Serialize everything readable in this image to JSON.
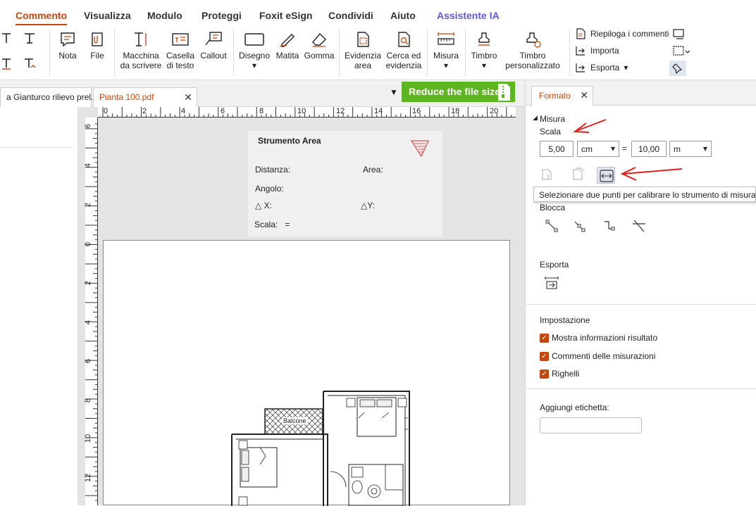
{
  "tabs": [
    {
      "label": "Commento"
    },
    {
      "label": "Visualizza"
    },
    {
      "label": "Modulo"
    },
    {
      "label": "Proteggi"
    },
    {
      "label": "Foxit eSign"
    },
    {
      "label": "Condividi"
    },
    {
      "label": "Aiuto"
    },
    {
      "label": "Assistente IA"
    }
  ],
  "ribbon": {
    "nota": "Nota",
    "file": "File",
    "macchina_1": "Macchina",
    "macchina_2": "da scrivere",
    "casella_1": "Casella",
    "casella_2": "di testo",
    "callout": "Callout",
    "disegno": "Disegno",
    "matita": "Matita",
    "gomma": "Gomma",
    "evidenzia_1": "Evidenzia",
    "evidenzia_2": "area",
    "cerca_1": "Cerca ed",
    "cerca_2": "evidenzia",
    "misura": "Misura",
    "timbro": "Timbro",
    "timbro_pers_1": "Timbro",
    "timbro_pers_2": "personalizzato",
    "riepiloga": "Riepiloga i commenti",
    "importa": "Importa",
    "esporta": "Esporta"
  },
  "doc_tabs": [
    {
      "label": "a Gianturco rilievo prel..."
    },
    {
      "label": "Pianta 100.pdf"
    }
  ],
  "reduce_banner": "Reduce the file size",
  "ruler_top_ticks": [
    "0",
    "2",
    "4",
    "6",
    "8",
    "10",
    "12",
    "14",
    "16",
    "18",
    "20"
  ],
  "ruler_left_ticks": [
    "6",
    "4",
    "2",
    "0",
    "2",
    "4",
    "6",
    "8",
    "10",
    "12"
  ],
  "measure_box": {
    "title": "Strumento Area",
    "distanza": "Distanza:",
    "area": "Area:",
    "angolo": "Angolo:",
    "dx": "X:",
    "dy": "Y:",
    "scala": "Scala:",
    "eq": "="
  },
  "plan": {
    "balcone": "Balcone"
  },
  "panel": {
    "tab": "Formato",
    "misura": "Misura",
    "scala": "Scala",
    "scale_left_value": "5,00",
    "scale_left_unit": "cm",
    "eq": "=",
    "scale_right_value": "10,00",
    "scale_right_unit": "m",
    "tooltip": "Selezionare due punti per calibrare lo strumento di misurazione",
    "blocca": "Blocca",
    "esporta": "Esporta",
    "impostazione": "Impostazione",
    "opt1": "Mostra informazioni risultato",
    "opt2": "Commenti delle misurazioni",
    "opt3": "Righelli",
    "aggiungi": "Aggiungi etichetta:",
    "label_value": ""
  },
  "colors": {
    "accent": "#c4480c",
    "ai": "#5a5ae0",
    "banner": "#5db520",
    "arrow": "#e02020"
  }
}
